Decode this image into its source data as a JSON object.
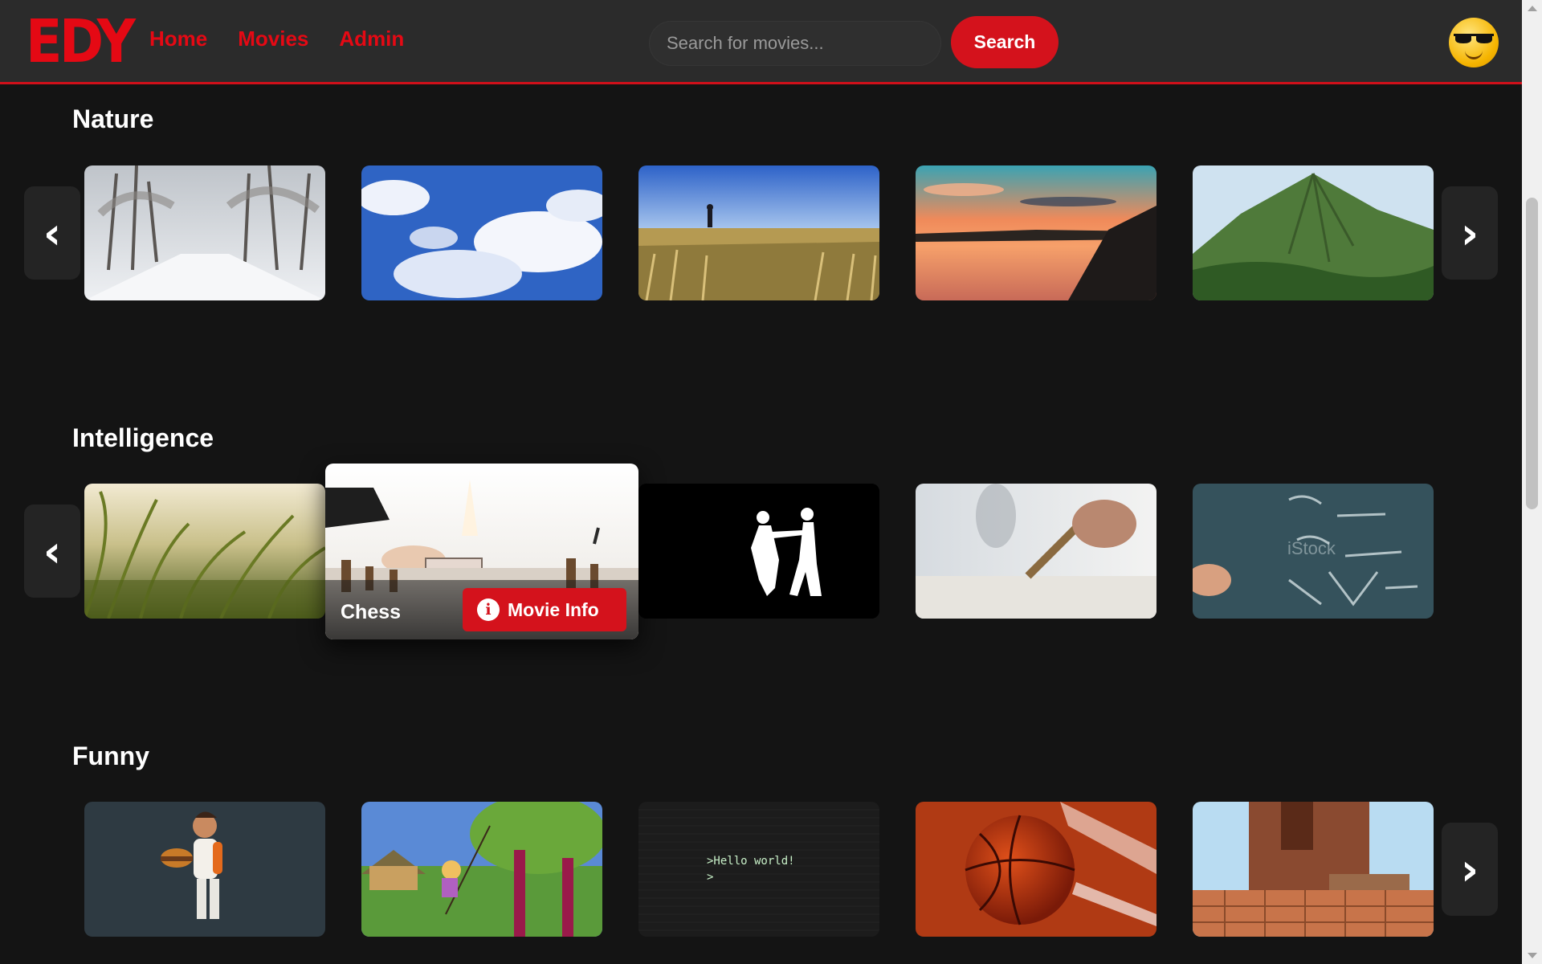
{
  "header": {
    "logo": "EDY",
    "nav": [
      "Home",
      "Movies",
      "Admin"
    ],
    "search_placeholder": "Search for movies...",
    "search_button": "Search",
    "avatar_icon": "sunglasses-emoji-icon"
  },
  "sections": [
    {
      "title": "Nature",
      "movies": [
        "snowy-forest-road",
        "blue-sky-clouds",
        "wheat-field-runner",
        "sunset-lake",
        "green-mountain"
      ]
    },
    {
      "title": "Intelligence",
      "movies": [
        "grass-closeup",
        "chess",
        "dance-silhouette",
        "pencil-writing",
        "chalkboard-equations"
      ],
      "expanded": {
        "title": "Chess",
        "button": "Movie Info"
      },
      "watermark": "iStock"
    },
    {
      "title": "Funny",
      "movies": [
        "cartoon-burger-boy",
        "cartoon-girl-swing",
        "terminal-hello-world",
        "basketball-3d",
        "blocky-tower"
      ],
      "terminal_lines": [
        ">Hello world!",
        ">"
      ]
    }
  ],
  "arrows": {
    "prev": "‹",
    "next": "›"
  },
  "colors": {
    "accent": "#e50914",
    "background": "#141414",
    "header": "#2b2b2b"
  }
}
